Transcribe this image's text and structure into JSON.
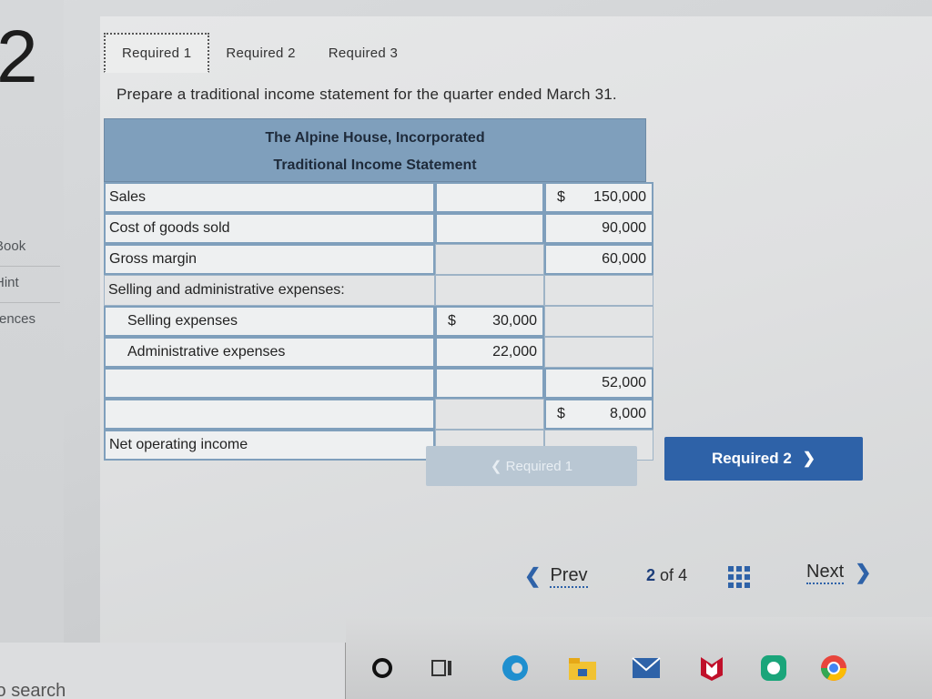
{
  "question": {
    "number": "2"
  },
  "side_links": [
    "Book",
    "Hint",
    "rences"
  ],
  "tabs": [
    "Required 1",
    "Required 2",
    "Required 3"
  ],
  "instructions": "Prepare a traditional income statement for the quarter ended March 31.",
  "statement": {
    "company": "The Alpine House, Incorporated",
    "title": "Traditional Income Statement",
    "rows": [
      {
        "label": "Sales",
        "mid_sym": "",
        "mid_val": "",
        "right_sym": "$",
        "right_val": "150,000"
      },
      {
        "label": "Cost of goods sold",
        "mid_sym": "",
        "mid_val": "",
        "right_sym": "",
        "right_val": "90,000"
      },
      {
        "label": "Gross margin",
        "mid_sym": "",
        "mid_val": "",
        "right_sym": "",
        "right_val": "60,000"
      },
      {
        "label": "Selling and administrative expenses:",
        "mid_sym": "",
        "mid_val": "",
        "right_sym": "",
        "right_val": ""
      },
      {
        "label": "Selling expenses",
        "mid_sym": "$",
        "mid_val": "30,000",
        "right_sym": "",
        "right_val": ""
      },
      {
        "label": "Administrative expenses",
        "mid_sym": "",
        "mid_val": "22,000",
        "right_sym": "",
        "right_val": ""
      },
      {
        "label": "",
        "mid_sym": "",
        "mid_val": "",
        "right_sym": "",
        "right_val": "52,000"
      },
      {
        "label": "",
        "mid_sym": "",
        "mid_val": "",
        "right_sym": "$",
        "right_val": "8,000"
      },
      {
        "label": "Net operating income",
        "mid_sym": "",
        "mid_val": "",
        "right_sym": "",
        "right_val": ""
      }
    ]
  },
  "nav_buttons": {
    "prev": "Required 1",
    "next": "Required 2"
  },
  "pager": {
    "prev": "Prev",
    "current": "2",
    "of": "of",
    "total": "4",
    "next": "Next"
  },
  "taskbar": {
    "search": "to search"
  }
}
